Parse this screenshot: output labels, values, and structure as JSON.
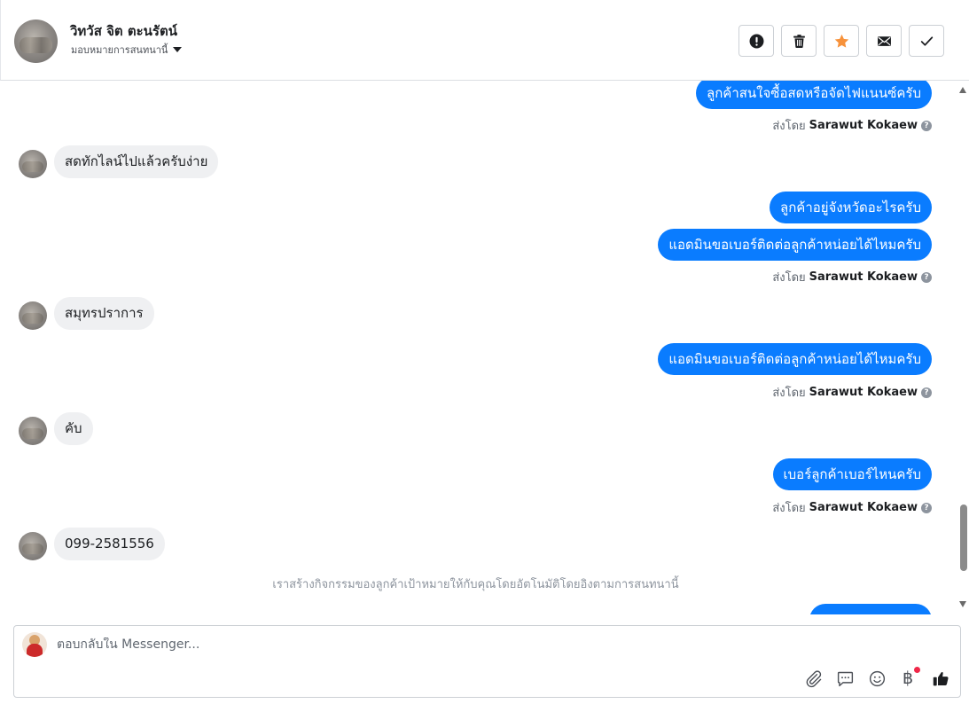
{
  "header": {
    "contact_name": "วิทวัส จิต ตะนรัตน์",
    "assign_label": "มอบหมายการสนทนานี้",
    "actions": [
      {
        "name": "spam-button",
        "icon": "exclamation-circle-icon"
      },
      {
        "name": "delete-button",
        "icon": "trash-icon"
      },
      {
        "name": "star-button",
        "icon": "star-icon",
        "color": "#f7923b"
      },
      {
        "name": "mark-unread-button",
        "icon": "envelope-icon"
      },
      {
        "name": "mark-done-button",
        "icon": "check-icon"
      }
    ]
  },
  "thread": {
    "messages": [
      {
        "direction": "outgoing",
        "text": "ลูกค้าสนใจซื้อสดหรือจัดไฟแนนซ์ครับ"
      },
      {
        "direction": "sent_by",
        "prefix": "ส่งโดย",
        "agent": "Sarawut Kokaew"
      },
      {
        "direction": "incoming",
        "text": "สดทักไลน์ไปแล้วครับง่าย"
      },
      {
        "direction": "outgoing",
        "text": "ลูกค้าอยู่จังหวัดอะไรครับ"
      },
      {
        "direction": "outgoing",
        "text": "แอดมินขอเบอร์ติดต่อลูกค้าหน่อยได้ไหมครับ"
      },
      {
        "direction": "sent_by",
        "prefix": "ส่งโดย",
        "agent": "Sarawut Kokaew"
      },
      {
        "direction": "incoming",
        "text": "สมุทรปราการ"
      },
      {
        "direction": "outgoing",
        "text": "แอดมินขอเบอร์ติดต่อลูกค้าหน่อยได้ไหมครับ"
      },
      {
        "direction": "sent_by",
        "prefix": "ส่งโดย",
        "agent": "Sarawut Kokaew"
      },
      {
        "direction": "incoming",
        "text": "คับ"
      },
      {
        "direction": "outgoing",
        "text": "เบอร์ลูกค้าเบอร์ไหนครับ"
      },
      {
        "direction": "sent_by",
        "prefix": "ส่งโดย",
        "agent": "Sarawut Kokaew"
      },
      {
        "direction": "incoming",
        "text": "099-2581556"
      },
      {
        "direction": "system",
        "text": "เราสร้างกิจกรรมของลูกค้าเป้าหมายให้กับคุณโดยอัตโนมัติโดยอิงตามการสนทนานี้"
      }
    ]
  },
  "composer": {
    "placeholder": "ตอบกลับใน Messenger...",
    "tools": [
      "paperclip-icon",
      "saved-reply-icon",
      "emoji-icon",
      "baht-payment-icon",
      "thumbs-up-icon"
    ],
    "baht_symbol": "฿",
    "accent": "#0a7cff"
  }
}
